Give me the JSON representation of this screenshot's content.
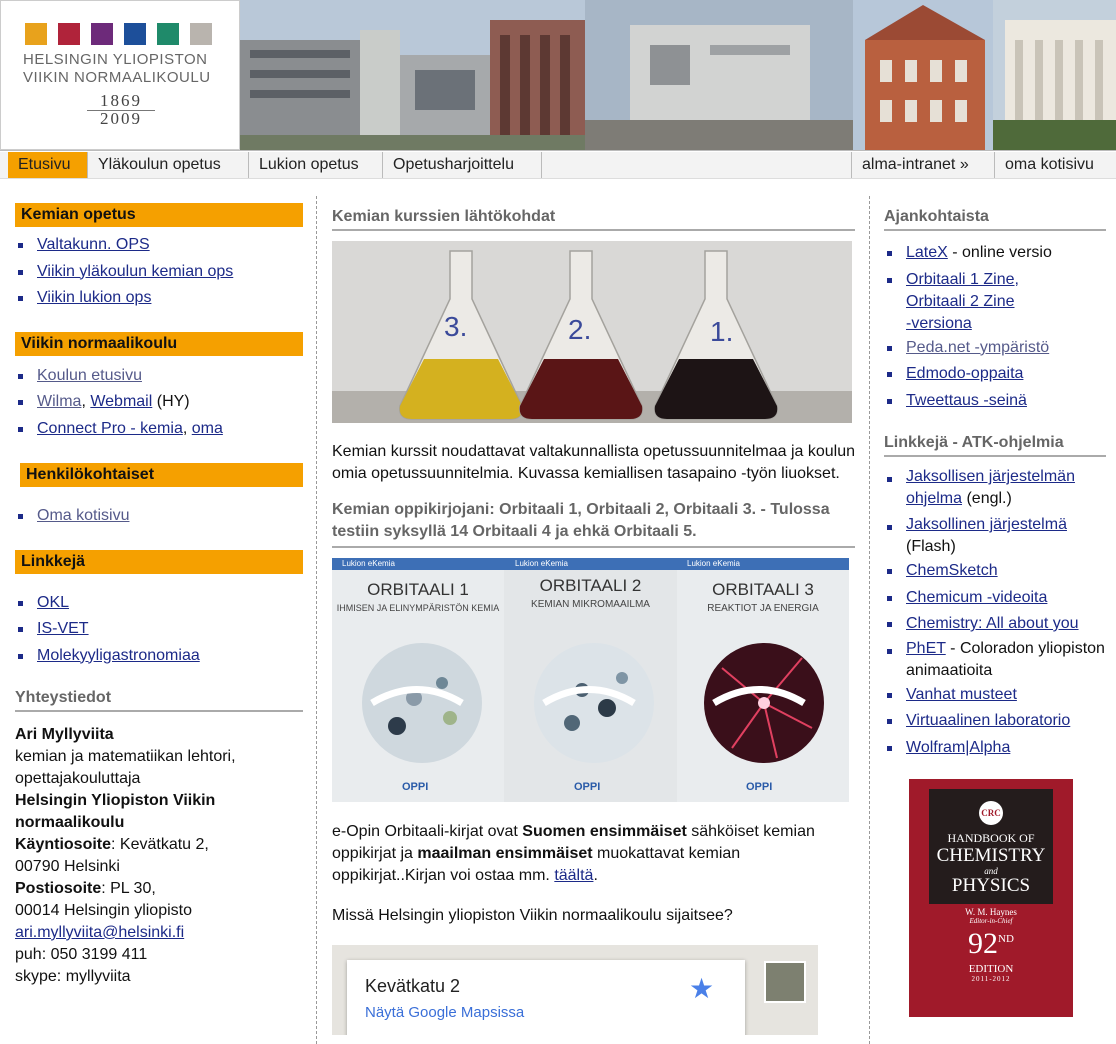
{
  "header": {
    "logo_line1": "HELSINGIN YLIOPISTON",
    "logo_line2": "VIIKIN NORMAALIKOULU",
    "logo_year1": "1869",
    "logo_year2": "2009",
    "logo_colors": [
      "#e8a21c",
      "#b0233a",
      "#6d2a7a",
      "#1d4f9a",
      "#1f8a6a",
      "#b9b4ae"
    ]
  },
  "nav": {
    "items": [
      "Etusivu",
      "Yläkoulun opetus",
      "Lukion opetus",
      "Opetusharjoittelu"
    ],
    "right_items": [
      "alma-intranet »",
      "oma kotisivu"
    ],
    "active_color": "#f5a000"
  },
  "left": {
    "kemian_title": "Kemian opetus",
    "kemian_links": [
      "Valtakunn. OPS",
      "Viikin yläkoulun kemian ops",
      "Viikin lukion ops"
    ],
    "viikin_title": "Viikin normaalikoulu",
    "koulun_etusivu": "Koulun etusivu",
    "wilma": "Wilma",
    "comma": ",",
    "webmail": "Webmail",
    "hy": "(HY)",
    "connect": "Connect Pro - kemia",
    "oma": "oma",
    "henk_title": "Henkilökohtaiset",
    "oma_kotisivu": "Oma kotisivu",
    "linkkeja_title": "Linkkejä",
    "linkkeja_links": [
      "OKL",
      "IS-VET",
      "Molekyyligastronomiaa"
    ],
    "yhteys_title": "Yhteystiedot",
    "name": "Ari Myllyviita",
    "role1": "kemian ja matematiikan lehtori,",
    "role2": "opettajakouluttaja",
    "school": "Helsingin Yliopiston Viikin normaalikoulu",
    "kaynti_label": "Käyntiosoite",
    "kaynti_value": ": Kevätkatu 2,",
    "kaynti_city": "00790 Helsinki",
    "posti_label": "Postiosoite",
    "posti_value": ": PL 30,",
    "posti_city": "00014 Helsingin yliopisto",
    "email": "ari.myllyviita@helsinki.fi",
    "phone": "puh: 050 3199 411",
    "skype": "skype: myllyviita"
  },
  "center": {
    "heading1": "Kemian kurssien lähtökohdat",
    "flask_labels": [
      "3.",
      "2.",
      "1."
    ],
    "intro": "Kemian kurssit noudattavat valtakunnallista opetussuunnitelmaa ja koulun omia opetussuunnitelmia. Kuvassa kemiallisen tasapaino -työn liuokset.",
    "heading2": "Kemian oppikirjojani: Orbitaali 1, Orbitaali 2, Orbitaali 3. - Tulossa testiin syksyllä 14 Orbitaali 4 ja ehkä Orbitaali 5.",
    "books": [
      {
        "series": "Lukion eKemia",
        "title": "ORBITAALI 1",
        "subtitle": "IHMISEN JA ELINYMPÄRISTÖN KEMIA",
        "publisher": "OPPI"
      },
      {
        "series": "Lukion eKemia",
        "title": "ORBITAALI 2",
        "subtitle": "KEMIAN MIKROMAAILMA",
        "publisher": "OPPI"
      },
      {
        "series": "Lukion eKemia",
        "title": "ORBITAALI 3",
        "subtitle": "REAKTIOT JA ENERGIA",
        "publisher": "OPPI"
      }
    ],
    "p2_a": "e-Opin Orbitaali-kirjat ovat ",
    "p2_b": "Suomen ensimmäiset",
    "p2_c": " sähköiset kemian oppikirjat ja ",
    "p2_d": "maailman ensimmäiset",
    "p2_e": " muokattavat kemian oppikirjat..Kirjan voi ostaa mm. ",
    "p2_link": "täältä",
    "p2_end": ".",
    "question": "Missä Helsingin yliopiston Viikin normaalikoulu sijaitsee?",
    "map_title": "Kevätkatu 2",
    "map_link": "Näytä Google Mapsissa"
  },
  "right": {
    "ajank_title": "Ajankohtaista",
    "latex": "LateX",
    "latex_suffix": " - online versio",
    "orb_zine1": "Orbitaali 1 Zine,",
    "orb_zine2": "Orbitaali 2 Zine",
    "orb_zine3": "-versiona",
    "peda": "Peda.net -ympäristö",
    "edmodo": "Edmodo-oppaita",
    "tweet": "Tweettaus -seinä",
    "atk_title": "Linkkejä - ATK-ohjelmia",
    "jaks1": "Jaksollisen järjestelmän ohjelma",
    "jaks1_suffix": " (engl.)",
    "jaks2": "Jaksollinen järjestelmä",
    "jaks2_suffix": " (Flash)",
    "chemsketch": "ChemSketch",
    "chemicum": "Chemicum -videoita",
    "chemistry": "Chemistry: All about you",
    "phet": "PhET",
    "phet_suffix": " - Coloradon yliopiston animaatioita",
    "vanhat": "Vanhat musteet",
    "virtuaalinen": "Virtuaalinen laboratorio",
    "wolfram": "Wolfram|Alpha",
    "crc": "CRC",
    "handbook_of": "HANDBOOK OF",
    "chemistry_word": "CHEMISTRY",
    "and_word": "and",
    "physics_word": "PHYSICS",
    "editor1": "W. M. Haynes",
    "editor2": "Editor-in-Chief",
    "edition_num": "92",
    "edition_sup": "ND",
    "edition_word": "EDITION",
    "edition_years": "2011-2012"
  }
}
